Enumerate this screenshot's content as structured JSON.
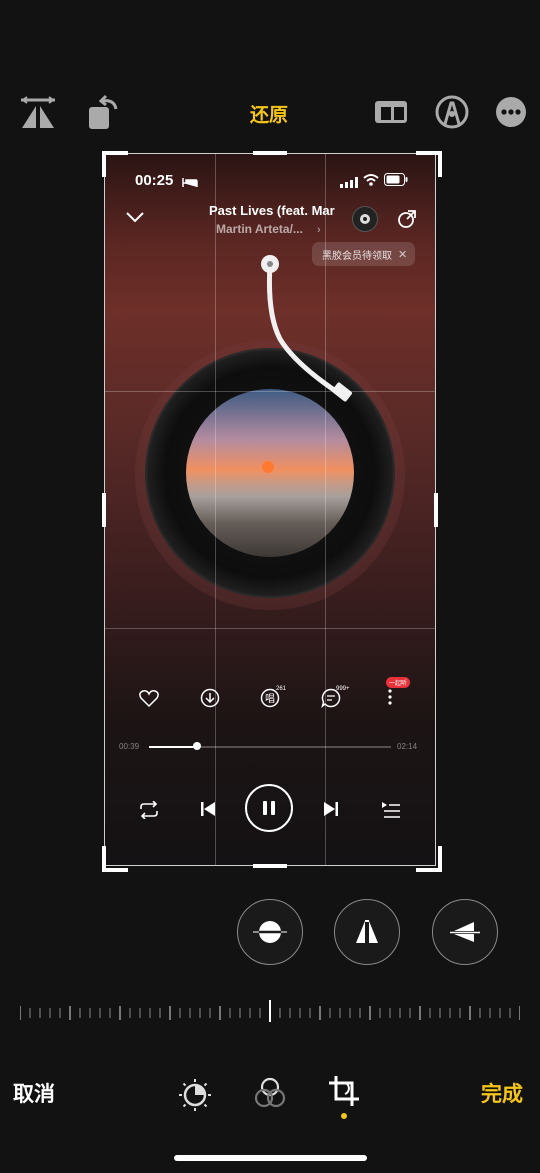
{
  "toolbar": {
    "restore_label": "还原",
    "left_icons": [
      "flip-horizontal-icon",
      "rotate-icon"
    ],
    "right_icons": [
      "aspect-ratio-icon",
      "markup-icon",
      "more-icon"
    ],
    "accent_color": "#f5c518"
  },
  "screenshot": {
    "status_time": "00:25",
    "song_title": "Past Lives (feat. Mar",
    "song_artist": "Martin Arteta/...",
    "vip_pill": "黑胶会员待领取",
    "comment_count": "999+",
    "sing_count": "261",
    "listen_badge": "一起听",
    "elapsed": "00:39",
    "duration": "02:14",
    "progress": 0.2
  },
  "adjust_buttons": [
    "straighten-icon",
    "vertical-perspective-icon",
    "horizontal-perspective-icon"
  ],
  "bottom": {
    "cancel_label": "取消",
    "done_label": "完成",
    "modes": [
      "adjust-icon",
      "filters-icon",
      "crop-icon"
    ],
    "active_mode": "crop-icon"
  }
}
